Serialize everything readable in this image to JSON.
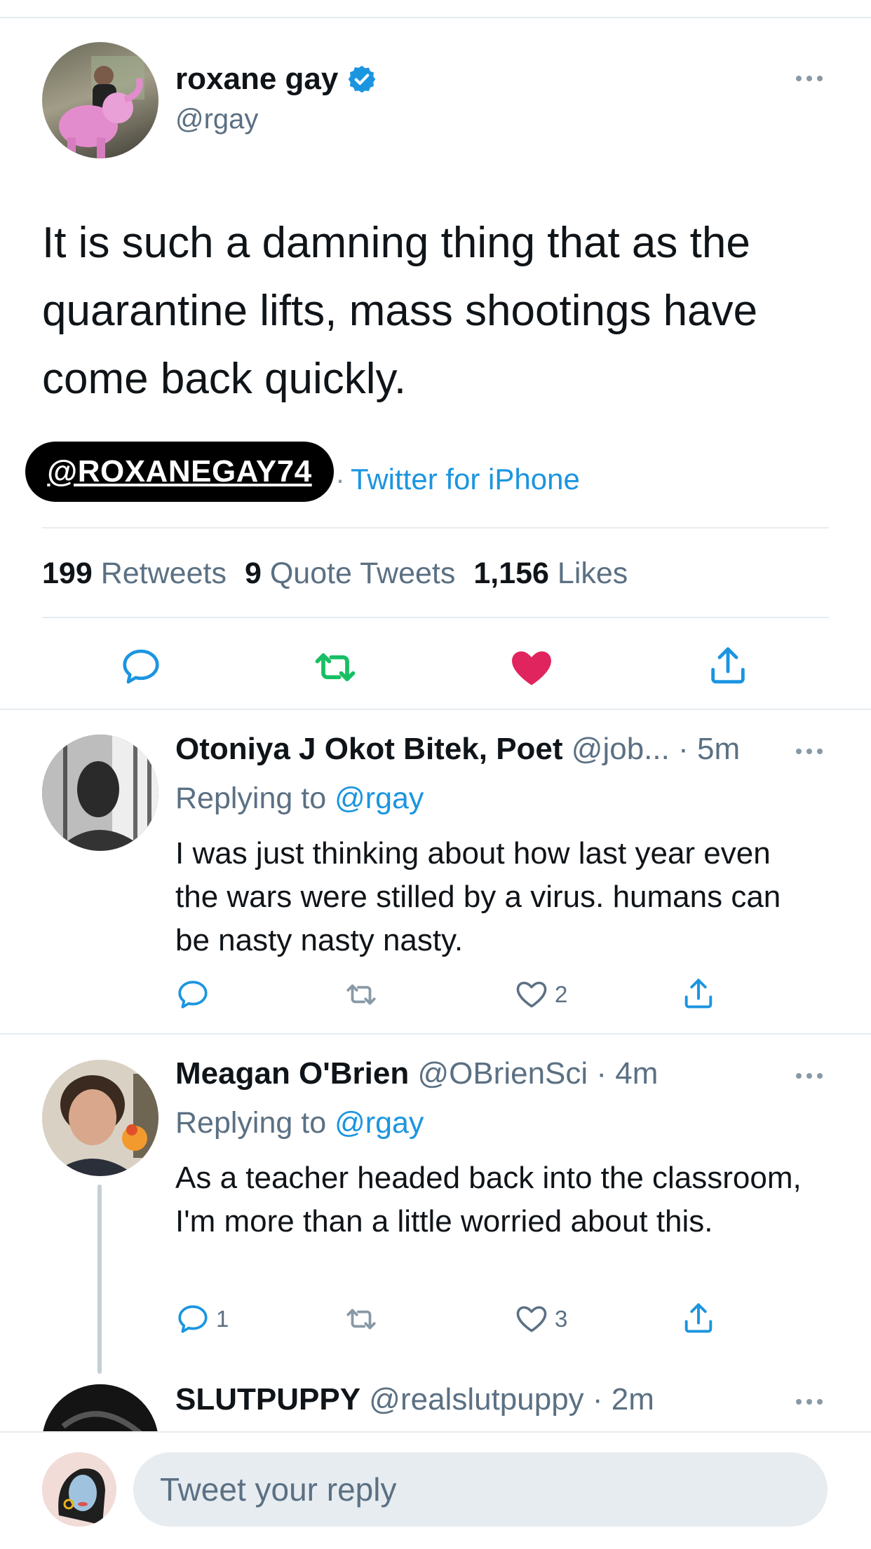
{
  "tweet": {
    "display_name": "roxane gay",
    "handle": "@rgay",
    "text": "It is such a damning thing that as the quarantine lifts, mass shootings have come back quickly.",
    "watermark": "@ROXANEGAY74",
    "source_sep": "·",
    "source": "Twitter for iPhone",
    "stats": {
      "retweets_count": "199",
      "retweets_label": "Retweets",
      "quotes_count": "9",
      "quotes_label": "Quote Tweets",
      "likes_count": "1,156",
      "likes_label": "Likes"
    }
  },
  "replies": [
    {
      "name": "Otoniya J Okot Bitek, Poet",
      "handle": "@job...",
      "time": "· 5m",
      "replying_prefix": "Replying to",
      "replying_to": "@rgay",
      "text": "I was just thinking about how last year even the wars were stilled by a virus. humans can be nasty nasty nasty.",
      "reply_count": "",
      "like_count": "2"
    },
    {
      "name": "Meagan O'Brien",
      "handle": "@OBrienSci",
      "time": "· 4m",
      "replying_prefix": "Replying to",
      "replying_to": "@rgay",
      "text": "As a teacher headed back into the classroom, I'm more than a little worried about this.",
      "reply_count": "1",
      "like_count": "3"
    },
    {
      "name": "SLUTPUPPY",
      "handle": "@realslutpuppy",
      "time": "· 2m"
    }
  ],
  "composer": {
    "placeholder": "Tweet your reply"
  },
  "colors": {
    "accent": "#1b95e0",
    "retweet_green": "#17bf63",
    "like_red": "#e0245e",
    "divider": "#e6ecf0"
  }
}
